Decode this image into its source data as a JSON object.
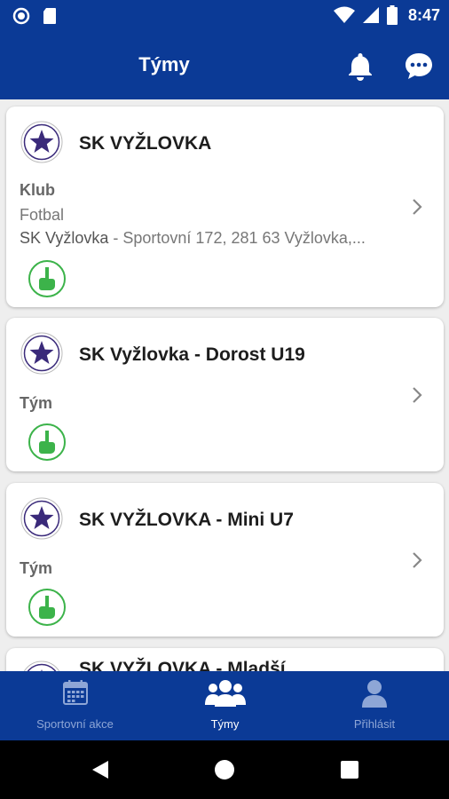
{
  "status_bar": {
    "time": "8:47",
    "icons": [
      "circle-status-icon",
      "sd-card-icon",
      "wifi-icon",
      "signal-icon",
      "battery-icon"
    ]
  },
  "app_bar": {
    "title": "Týmy",
    "icons": [
      "bell-icon",
      "chat-icon"
    ]
  },
  "cards": [
    {
      "title": "SK VYŽLOVKA",
      "type": "Klub",
      "sport": "Fotbal",
      "club_name": "SK Vyžlovka",
      "address": " - Sportovní 172, 281 63 Vyžlovka,..."
    },
    {
      "title": "SK Vyžlovka - Dorost U19",
      "type": "Tým"
    },
    {
      "title": "SK VYŽLOVKA - Mini U7",
      "type": "Tým"
    },
    {
      "title": "SK VYŽLOVKA - Mladší"
    }
  ],
  "bottom_nav": {
    "items": [
      {
        "label": "Sportovní akce",
        "icon": "calendar-icon",
        "active": false
      },
      {
        "label": "Týmy",
        "icon": "team-icon",
        "active": true
      },
      {
        "label": "Přihlásit",
        "icon": "user-icon",
        "active": false
      }
    ]
  },
  "colors": {
    "primary": "#0b3a96",
    "badge_green": "#3cb34a",
    "background": "#eeeeee"
  }
}
